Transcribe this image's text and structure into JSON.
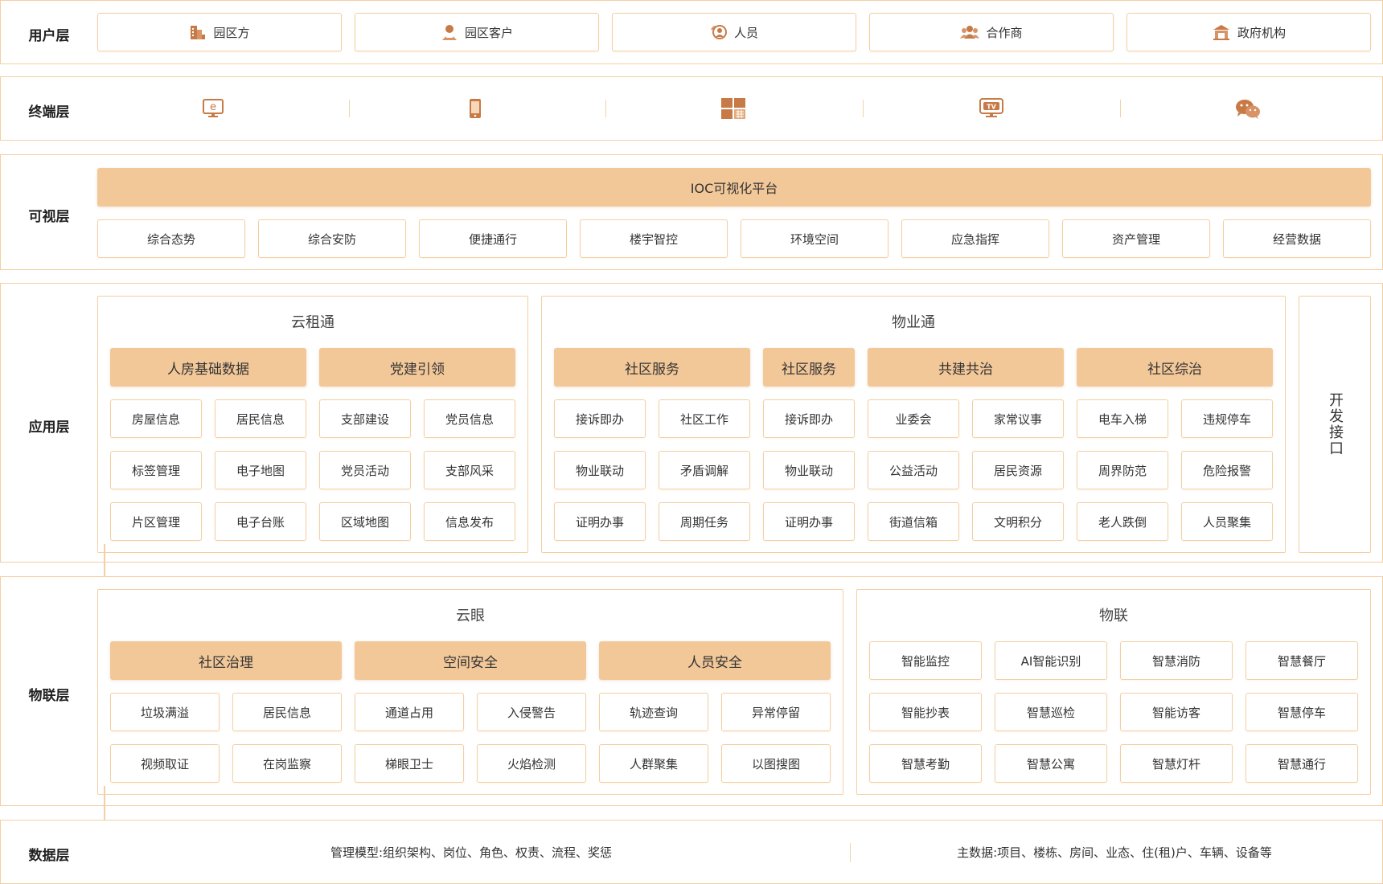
{
  "colors": {
    "accent": "#f3c899",
    "border": "#f3cfa2",
    "icon": "#c77a45"
  },
  "user_layer": {
    "label": "用户层",
    "items": [
      {
        "label": "园区方",
        "icon": "building-icon"
      },
      {
        "label": "园区客户",
        "icon": "customer-icon"
      },
      {
        "label": "人员",
        "icon": "person-icon"
      },
      {
        "label": "合作商",
        "icon": "partner-icon"
      },
      {
        "label": "政府机构",
        "icon": "government-icon"
      }
    ]
  },
  "terminal_layer": {
    "label": "终端层",
    "icons": [
      "web-browser-icon",
      "mobile-phone-icon",
      "tile-screen-icon",
      "tv-icon",
      "wechat-icon"
    ]
  },
  "visual_layer": {
    "label": "可视层",
    "platform": "IOC可视化平台",
    "items": [
      "综合态势",
      "综合安防",
      "便捷通行",
      "楼宇智控",
      "环境空间",
      "应急指挥",
      "资产管理",
      "经营数据"
    ]
  },
  "app_layer": {
    "label": "应用层",
    "yunzutong": {
      "title": "云租通",
      "groups": [
        {
          "header": "人房基础数据",
          "items": [
            "房屋信息",
            "居民信息",
            "标签管理",
            "电子地图",
            "片区管理",
            "电子台账"
          ]
        },
        {
          "header": "党建引领",
          "items": [
            "支部建设",
            "党员信息",
            "党员活动",
            "支部风采",
            "区域地图",
            "信息发布"
          ]
        }
      ]
    },
    "wuyetong": {
      "title": "物业通",
      "headers": [
        "社区服务",
        "社区服务",
        "共建共治",
        "社区综治"
      ],
      "col1": [
        "接诉即办",
        "物业联动",
        "证明办事"
      ],
      "col2": [
        "社区工作",
        "矛盾调解",
        "周期任务"
      ],
      "col3": [
        "接诉即办",
        "物业联动",
        "证明办事"
      ],
      "col4": [
        "业委会",
        "公益活动",
        "街道信箱"
      ],
      "col5": [
        "家常议事",
        "居民资源",
        "文明积分"
      ],
      "col6": [
        "电车入梯",
        "周界防范",
        "老人跌倒"
      ],
      "col7": [
        "违规停车",
        "危险报警",
        "人员聚集"
      ]
    },
    "open_api": "开发接口"
  },
  "iot_layer": {
    "label": "物联层",
    "yunyan": {
      "title": "云眼",
      "groups": [
        {
          "header": "社区治理",
          "items": [
            "垃圾满溢",
            "居民信息",
            "视频取证",
            "在岗监察"
          ]
        },
        {
          "header": "空间安全",
          "items": [
            "通道占用",
            "入侵警告",
            "梯眼卫士",
            "火焰检测"
          ]
        },
        {
          "header": "人员安全",
          "items": [
            "轨迹查询",
            "异常停留",
            "人群聚集",
            "以图搜图"
          ]
        }
      ]
    },
    "wulian": {
      "title": "物联",
      "items": [
        "智能监控",
        "AI智能识别",
        "智慧消防",
        "智慧餐厅",
        "智能抄表",
        "智慧巡检",
        "智能访客",
        "智慧停车",
        "智慧考勤",
        "智慧公寓",
        "智慧灯杆",
        "智慧通行"
      ]
    }
  },
  "data_layer": {
    "label": "数据层",
    "left": "管理模型:组织架构、岗位、角色、权责、流程、奖惩",
    "right": "主数据:项目、楼栋、房间、业态、住(租)户、车辆、设备等"
  }
}
